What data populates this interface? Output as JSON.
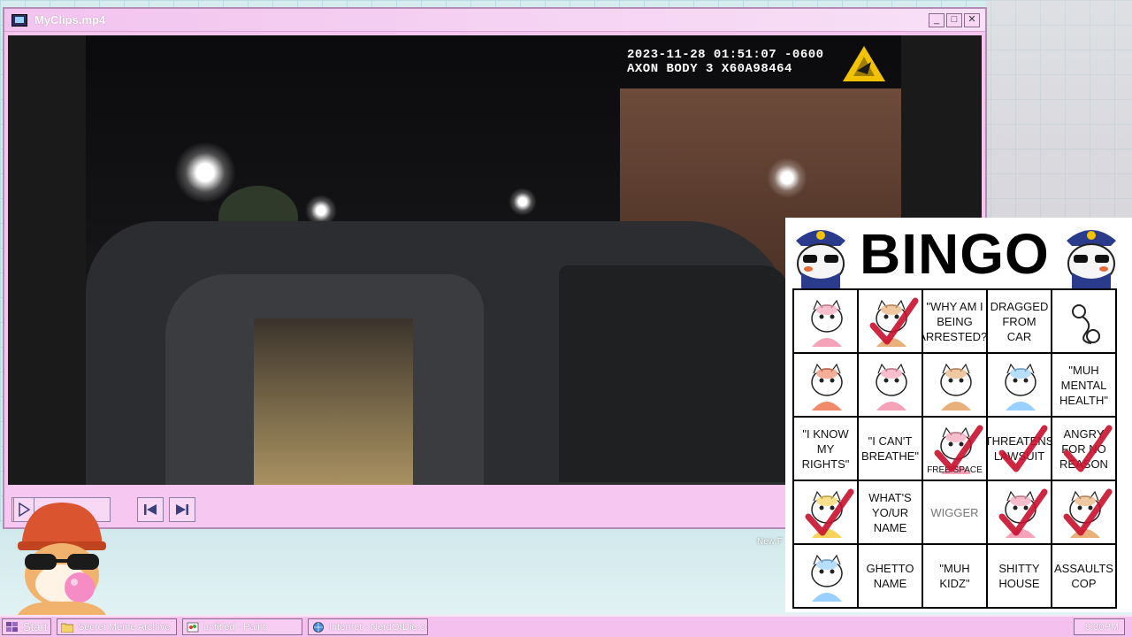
{
  "window": {
    "title": "MyClips.mp4",
    "buttons": {
      "minimize": "_",
      "maximize": "□",
      "close": "✕"
    }
  },
  "video": {
    "timestamp": "2023-11-28 01:51:07 -0600",
    "device": "AXON BODY 3 X60A98464"
  },
  "desktop": {
    "partial_icon_label": "New F"
  },
  "bingo": {
    "title": "BINGO",
    "cells": [
      {
        "label": "",
        "checked": false,
        "icon": "hijab-cat-icon"
      },
      {
        "label": "",
        "checked": true,
        "icon": "woman-face-photo"
      },
      {
        "label": "\"WHY AM I BEING ARRESTED?\"",
        "checked": false
      },
      {
        "label": "DRAGGED FROM CAR",
        "checked": false
      },
      {
        "label": "",
        "checked": false,
        "icon": "handcuffs-icon"
      },
      {
        "label": "",
        "checked": false,
        "icon": "crying-makeup-icon"
      },
      {
        "label": "",
        "checked": false,
        "icon": "cat-driving-icon"
      },
      {
        "label": "",
        "checked": false,
        "icon": "cartoon-boy-icon"
      },
      {
        "label": "",
        "checked": false,
        "icon": "sad-cat-icon"
      },
      {
        "label": "\"MUH MENTAL HEALTH\"",
        "checked": false
      },
      {
        "label": "\"I KNOW MY RIGHTS\"",
        "checked": false
      },
      {
        "label": "\"I CAN'T BREATHE\"",
        "checked": false
      },
      {
        "label": "FREE SPACE",
        "checked": true,
        "free": true,
        "icon": "badge-icon"
      },
      {
        "label": "THREATENS LAWSUIT",
        "checked": true
      },
      {
        "label": "ANGRY FOR NO REASON",
        "checked": true
      },
      {
        "label": "",
        "checked": true,
        "icon": "woman-cartoon-icon"
      },
      {
        "label": "WHAT'S YO/UR NAME",
        "checked": false
      },
      {
        "label": "WIGGER",
        "checked": false,
        "plain": true
      },
      {
        "label": "",
        "checked": true,
        "icon": "cat-hood-icon"
      },
      {
        "label": "",
        "checked": true,
        "icon": "angry-cat-icon"
      },
      {
        "label": "",
        "checked": false,
        "icon": "chubby-cat-icon"
      },
      {
        "label": "GHETTO NAME",
        "checked": false
      },
      {
        "label": "\"MUH KIDZ\"",
        "checked": false
      },
      {
        "label": "SHITTY HOUSE",
        "checked": false
      },
      {
        "label": "ASSAULTS COP",
        "checked": false
      }
    ]
  },
  "taskbar": {
    "start": "Start",
    "items": [
      {
        "label": "Secret Meme Archive",
        "icon": "folder-icon"
      },
      {
        "label": "untitled - Paint",
        "icon": "paint-icon"
      },
      {
        "label": "Internet - NerdOrDie.com",
        "icon": "globe-icon"
      }
    ],
    "clock": "9:30PM"
  },
  "colors": {
    "window_pink": "#f4c6ee",
    "check_red": "#c8102e",
    "title_text": "#ffffff"
  }
}
